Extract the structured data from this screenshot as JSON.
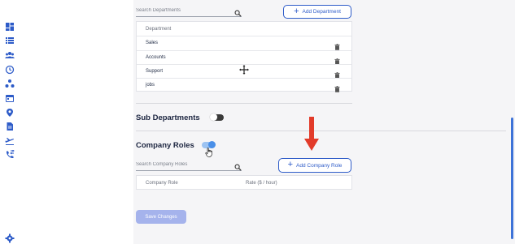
{
  "colors": {
    "primary": "#2d5bc8",
    "arrow": "#e23b2a",
    "toggle_on": "#4a8fe8"
  },
  "sidebar": {
    "icons": [
      "dashboard-icon",
      "list-icon",
      "team-icon",
      "clock-icon",
      "org-chart-icon",
      "calendar-icon",
      "location-icon",
      "document-icon",
      "flight-icon",
      "phone-transfer-icon",
      "settings-icon"
    ]
  },
  "departments": {
    "search_placeholder": "Search Departments",
    "add_button_label": "Add Department",
    "column_header": "Department",
    "rows": [
      "Sales",
      "Accounts",
      "Support",
      "jobs"
    ]
  },
  "sub_departments": {
    "title": "Sub Departments",
    "enabled": false
  },
  "company_roles": {
    "title": "Company Roles",
    "enabled": true,
    "search_placeholder": "Search Company Roles",
    "add_button_label": "Add Company Role",
    "columns": [
      "Company Role",
      "Rate ($ / hour)"
    ]
  },
  "save_button_label": "Save Changes"
}
